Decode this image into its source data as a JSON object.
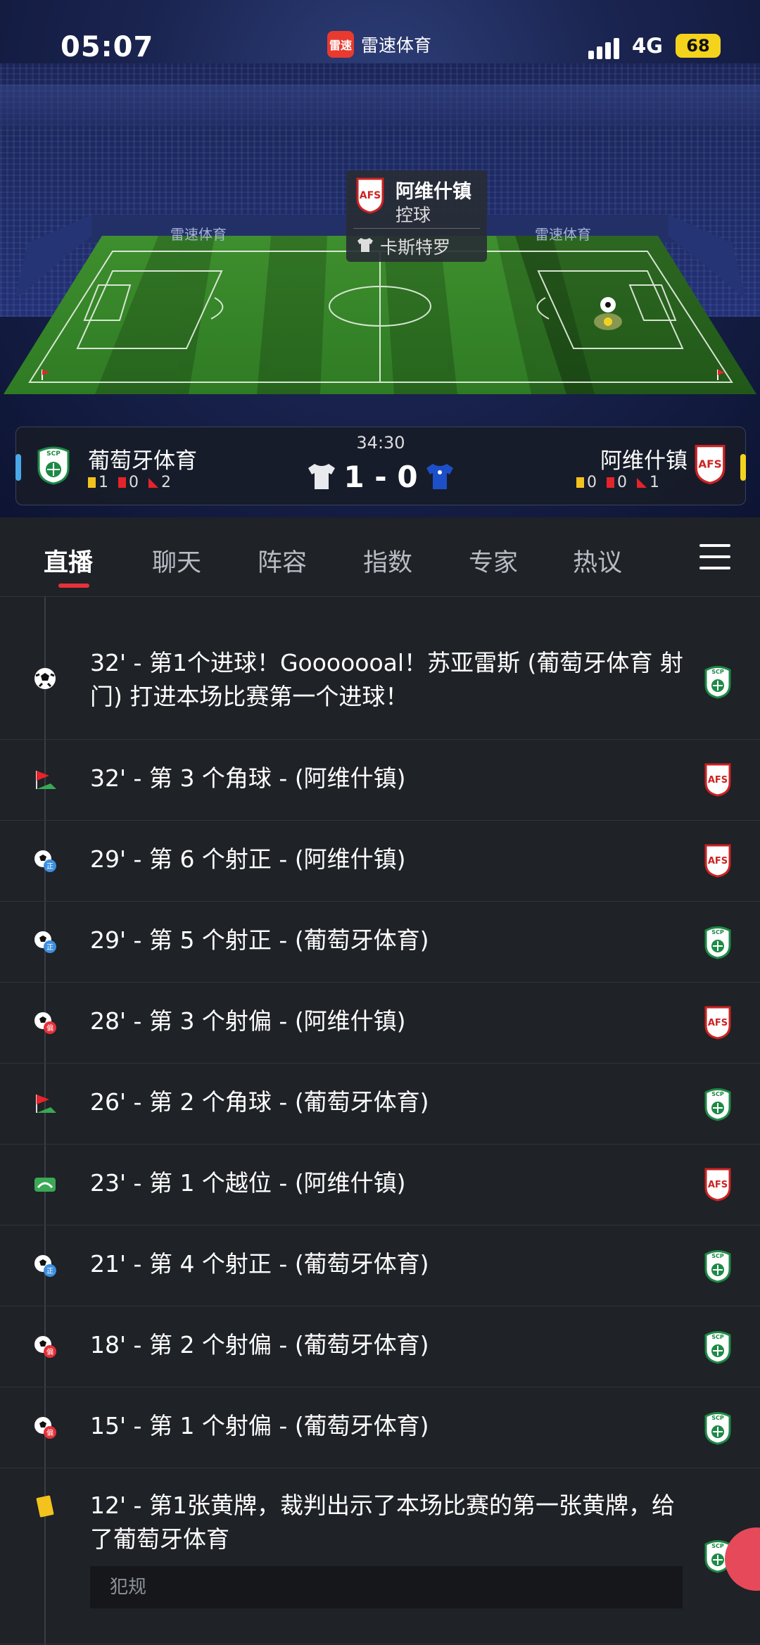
{
  "status_bar": {
    "time": "05:07",
    "app_name": "雷速体育",
    "app_logo_text": "雷速",
    "network": "4G",
    "battery": "68"
  },
  "field": {
    "ad_text": "雷速体育",
    "popup": {
      "team": "阿维什镇",
      "action": "控球",
      "player": "卡斯特罗"
    }
  },
  "scoreboard": {
    "clock": "34:30",
    "score": "1 - 0",
    "home": {
      "name": "葡萄牙体育",
      "yellow": "1",
      "red": "0",
      "corners": "2"
    },
    "away": {
      "name": "阿维什镇",
      "yellow": "0",
      "red": "0",
      "corners": "1"
    }
  },
  "tabs": [
    "直播",
    "聊天",
    "阵容",
    "指数",
    "专家",
    "热议"
  ],
  "events": [
    {
      "icon": "football-goal-icon",
      "text": "32' - 第1个进球！Gooooooal！苏亚雷斯 (葡萄牙体育 射门) 打进本场比赛第一个进球！",
      "team": "home"
    },
    {
      "icon": "corner-flag-icon",
      "text": "32' - 第 3 个角球 - (阿维什镇)",
      "team": "away"
    },
    {
      "icon": "shot-on-target-icon",
      "text": "29' - 第 6 个射正 - (阿维什镇)",
      "team": "away"
    },
    {
      "icon": "shot-on-target-icon",
      "text": "29' - 第 5 个射正 - (葡萄牙体育)",
      "team": "home"
    },
    {
      "icon": "shot-off-target-icon",
      "text": "28' - 第 3 个射偏 - (阿维什镇)",
      "team": "away"
    },
    {
      "icon": "corner-flag-icon",
      "text": "26' - 第 2 个角球 - (葡萄牙体育)",
      "team": "home"
    },
    {
      "icon": "offside-icon",
      "text": "23' - 第 1 个越位 - (阿维什镇)",
      "team": "away"
    },
    {
      "icon": "shot-on-target-icon",
      "text": "21' - 第 4 个射正 - (葡萄牙体育)",
      "team": "home"
    },
    {
      "icon": "shot-off-target-icon",
      "text": "18' - 第 2 个射偏 - (葡萄牙体育)",
      "team": "home"
    },
    {
      "icon": "shot-off-target-icon",
      "text": "15' - 第 1 个射偏 - (葡萄牙体育)",
      "team": "home"
    },
    {
      "icon": "yellow-card-icon",
      "text": "12' - 第1张黄牌，裁判出示了本场比赛的第一张黄牌，给了葡萄牙体育",
      "team": "home",
      "detail": "犯规"
    }
  ],
  "colors": {
    "accent": "#e5313a",
    "background": "#1f2226",
    "home_indicator": "#4aa8e8",
    "away_indicator": "#f4d31d"
  }
}
